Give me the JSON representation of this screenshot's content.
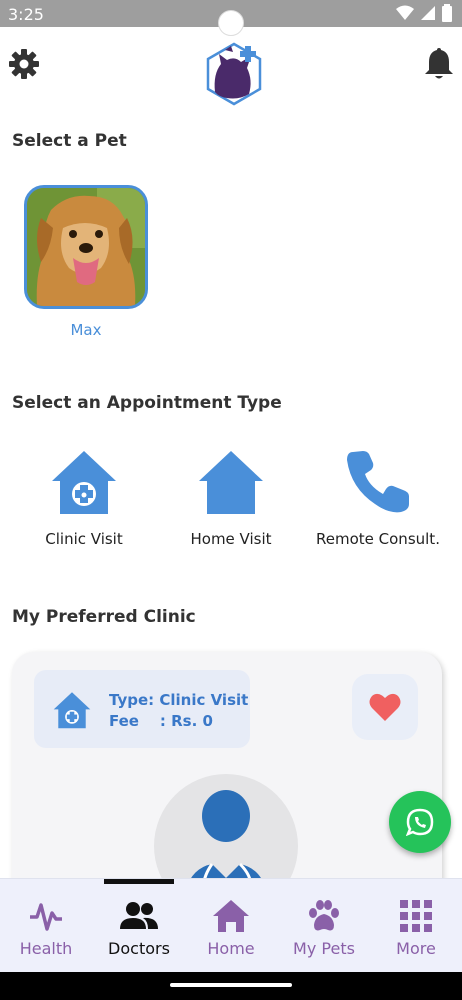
{
  "status_bar": {
    "time": "3:25"
  },
  "sections": {
    "select_pet": "Select a Pet",
    "select_appointment": "Select an Appointment Type",
    "preferred_clinic": "My Preferred Clinic"
  },
  "pets": [
    {
      "name": "Max"
    }
  ],
  "appointment_types": [
    {
      "label": "Clinic Visit",
      "icon": "clinic-house-icon"
    },
    {
      "label": "Home Visit",
      "icon": "house-icon"
    },
    {
      "label": "Remote Consult.",
      "icon": "phone-icon"
    }
  ],
  "clinic_card": {
    "type_line": "Type: Clinic Visit",
    "fee_line": "Fee    : Rs. 0"
  },
  "bottom_nav": {
    "active": "Doctors",
    "items": [
      {
        "label": "Health",
        "icon": "heartbeat-icon"
      },
      {
        "label": "Doctors",
        "icon": "people-icon"
      },
      {
        "label": "Home",
        "icon": "home-icon"
      },
      {
        "label": "My Pets",
        "icon": "paw-icon"
      },
      {
        "label": "More",
        "icon": "grid-icon"
      }
    ]
  },
  "colors": {
    "accent_blue": "#4a8fd9",
    "nav_purple": "#8a60a8",
    "whatsapp_green": "#25c35a",
    "heart_red": "#f06060"
  }
}
